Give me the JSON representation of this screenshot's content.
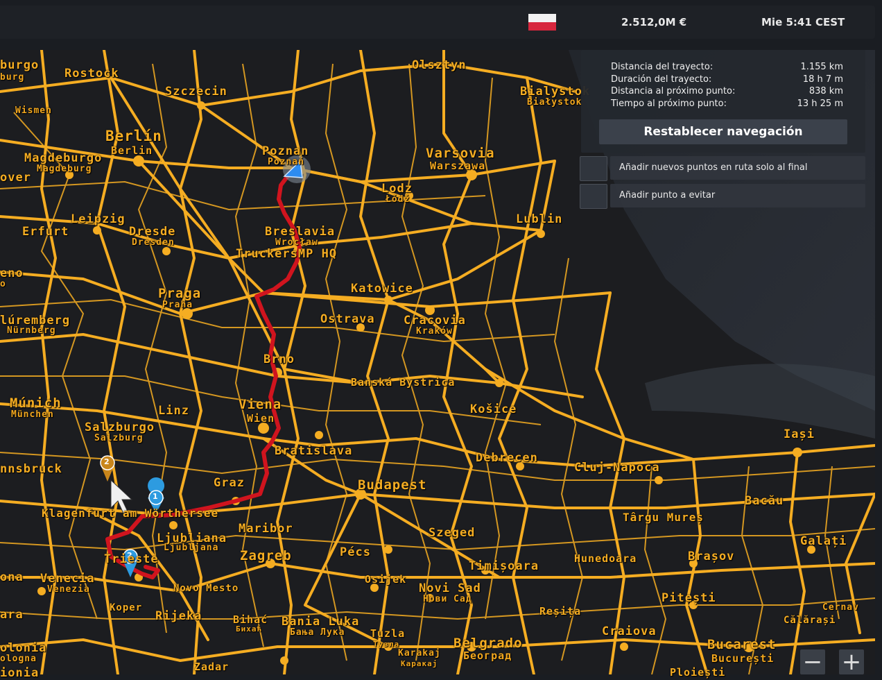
{
  "topbar": {
    "flag_icon": "poland-flag-icon",
    "money": "2.512,0M  €",
    "time": "Mie 5:41 CEST"
  },
  "route_info": {
    "rows": [
      {
        "label": "Distancia del trayecto:",
        "value": "1.155 km"
      },
      {
        "label": "Duración del trayecto:",
        "value": "18 h 7 m"
      },
      {
        "label": "Distancia al próximo punto:",
        "value": "838 km"
      },
      {
        "label": "Tiempo al próximo punto:",
        "value": "13 h 25 m"
      }
    ],
    "reset_label": "Restablecer navegación"
  },
  "options": [
    {
      "label": "Añadir nuevos puntos en ruta solo al final",
      "checked": false
    },
    {
      "label": "Añadir punto a evitar",
      "checked": false
    }
  ],
  "zoom": {
    "out_label": "−",
    "in_label": "+"
  },
  "markers": {
    "waypoint_1": "1",
    "waypoint_2_blue": "2",
    "waypoint_2_orange": "2"
  },
  "colors": {
    "road": "#f5ad22",
    "route": "#d0141e",
    "background": "#1a1d22"
  },
  "cities": {
    "c1": "burgo",
    "c2": "burg",
    "c3": "Rostock",
    "c4": "Szczecin",
    "c5": "Wismen",
    "c6": "Olsztyn",
    "c7": "Bialystok",
    "c8": "Białystok",
    "c9": "Berlín",
    "c10": "Berlin",
    "c11": "Magdeburgo",
    "c12": "Magdeburg",
    "c13": "over",
    "c14": "Poznan",
    "c15": "Poznań",
    "c16": "Varsovia",
    "c17": "Warszawa",
    "c18": "Lodz",
    "c19": "Łódź",
    "c20": "Leipzig",
    "c21": "Erfurt",
    "c22": "Dresde",
    "c23": "Dresden",
    "c24": "Lublin",
    "c25": "Breslavia",
    "c26": "Wrocław",
    "c27": "TruckersMP HQ",
    "c28": "eno",
    "c29": "o",
    "c30": "Katowice",
    "c31": "Praga",
    "c32": "Praha",
    "c33": "Ostrava",
    "c34": "Cracovia",
    "c35": "Kraków",
    "c36": "lúremberg",
    "c37": "Nürnberg",
    "c38": "Brno",
    "c39": "Banská Bystrica",
    "c40": "Múnich",
    "c41": "München",
    "c42": "Viena",
    "c43": "Wien",
    "c44": "Košice",
    "c45": "Linz",
    "c46": "Salzburgo",
    "c47": "Salzburg",
    "c48": "Iași",
    "c49": "Bratislava",
    "c50": "Debrecen",
    "c51": "nnsbruck",
    "c52": "Cluj-Napoca",
    "c53": "Graz",
    "c54": "Budapest",
    "c55": "Bacău",
    "c56": "Klagenfurt am Wörthersee",
    "c57": "Târgu Mureș",
    "c58": "Ljubliana",
    "c59": "Ljubljana",
    "c60": "Maribor",
    "c61": "Szeged",
    "c62": "Galați",
    "c63": "Trieste",
    "c64": "Zagreb",
    "c65": "Pécs",
    "c66": "Timișoara",
    "c67": "Hunedoara",
    "c68": "Brașov",
    "c69": "ona",
    "c70": "Venecia",
    "c71": "Venezia",
    "c72": "Osijek",
    "c73": "Novo Mesto",
    "c74": "Novi Sad",
    "c75": "Нови Сад",
    "c76": "Pitești",
    "c77": "Cernav",
    "c78": "Koper",
    "c79": "Rijeka",
    "c80": "Reșița",
    "c81": "ara",
    "c82": "Bihać",
    "c83": "Бихаћ",
    "c84": "Bania Luka",
    "c85": "Бања Лука",
    "c86": "Călărași",
    "c87": "Tuzla",
    "c88": "Тузла",
    "c89": "Craiova",
    "c90": "olonia",
    "c91": "ologna",
    "c92": "Karakaj",
    "c93": "Каракај",
    "c94": "Belgrado",
    "c95": "Београд",
    "c96": "Bucarest",
    "c97": "București",
    "c98": "Zadar",
    "c99": "Ploiești",
    "c100": "ionia"
  }
}
